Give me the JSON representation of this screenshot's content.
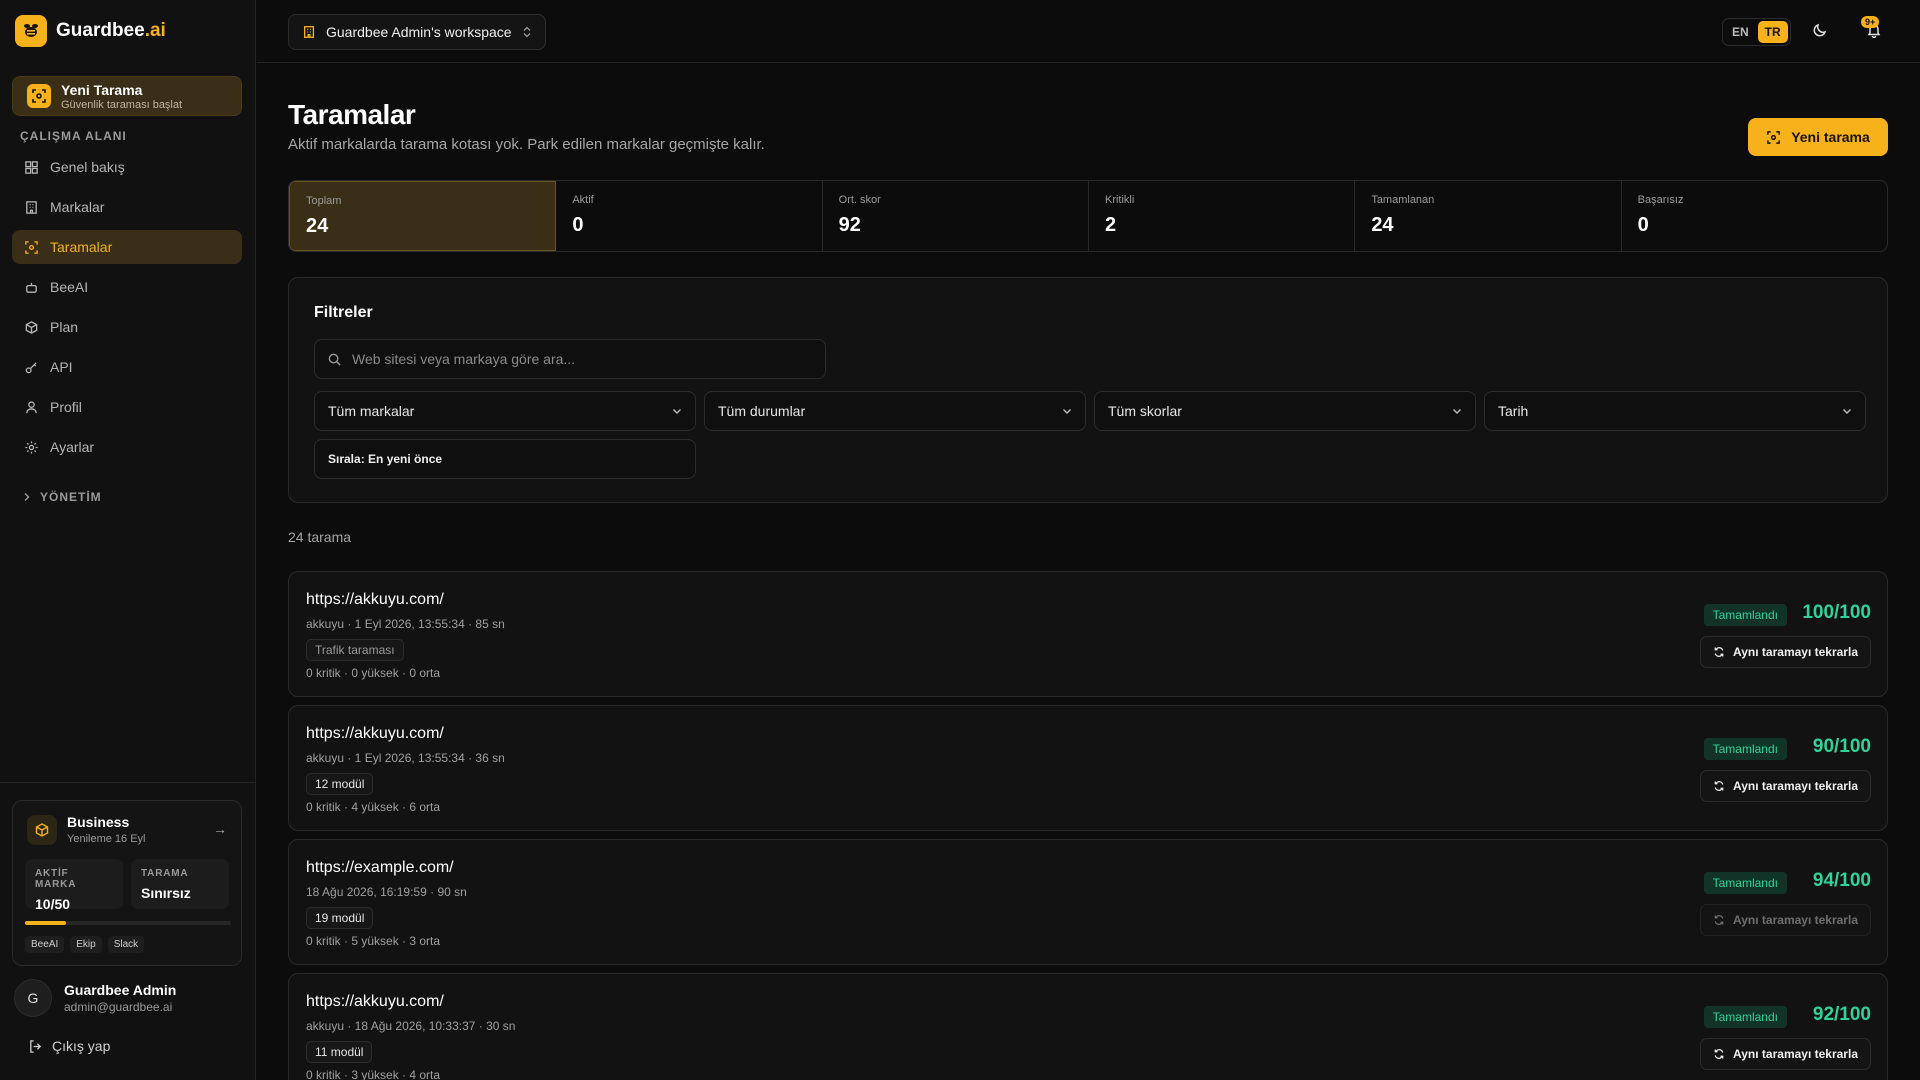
{
  "brand": {
    "name": "Guardbee",
    "suffix": ".ai",
    "color": "#f7b21b"
  },
  "sidebar": {
    "new_scan": {
      "title": "Yeni Tarama",
      "subtitle": "Güvenlik taraması başlat"
    },
    "section_label": "ÇALIŞMA ALANI",
    "items": [
      {
        "label": "Genel bakış",
        "icon": "grid-icon"
      },
      {
        "label": "Markalar",
        "icon": "building-icon"
      },
      {
        "label": "Taramalar",
        "icon": "scan-icon",
        "active": true
      },
      {
        "label": "BeeAI",
        "icon": "bot-icon"
      },
      {
        "label": "Plan",
        "icon": "box-icon"
      },
      {
        "label": "API",
        "icon": "key-icon"
      },
      {
        "label": "Profil",
        "icon": "user-icon"
      },
      {
        "label": "Ayarlar",
        "icon": "gear-icon"
      }
    ],
    "management_label": "YÖNETİM",
    "plan": {
      "name": "Business",
      "renewal": "Yenileme 16 Eyl",
      "active_brands_label": "AKTİF MARKA",
      "active_brands_value": "10/50",
      "active_brands_fraction": 0.2,
      "scan_label": "TARAMA",
      "scan_value": "Sınırsız",
      "features": [
        "BeeAI",
        "Ekip",
        "Slack"
      ]
    },
    "user": {
      "initial": "G",
      "name": "Guardbee Admin",
      "email": "admin@guardbee.ai"
    },
    "logout": "Çıkış yap"
  },
  "topbar": {
    "workspace": "Guardbee Admin's workspace",
    "lang_en": "EN",
    "lang_tr": "TR",
    "notifications_badge": "9+"
  },
  "page": {
    "title": "Taramalar",
    "subtitle": "Aktif markalarda tarama kotası yok. Park edilen markalar geçmişte kalır.",
    "new_button": "Yeni tarama"
  },
  "stats": [
    {
      "label": "Toplam",
      "value": "24"
    },
    {
      "label": "Aktif",
      "value": "0"
    },
    {
      "label": "Ort. skor",
      "value": "92"
    },
    {
      "label": "Kritikli",
      "value": "2"
    },
    {
      "label": "Tamamlanan",
      "value": "24"
    },
    {
      "label": "Başarısız",
      "value": "0"
    }
  ],
  "filters": {
    "title": "Filtreler",
    "search_placeholder": "Web sitesi veya markaya göre ara...",
    "brand": "Tüm markalar",
    "status": "Tüm durumlar",
    "score": "Tüm skorlar",
    "date": "Tarih",
    "sort": "Sırala: En yeni önce"
  },
  "results_count": "24 tarama",
  "scans": [
    {
      "url": "https://akkuyu.com/",
      "meta": "akkuyu · 1 Eyl 2026, 13:55:34 · 85 sn",
      "tag": "Trafik taraması",
      "severity": "0 kritik · 0 yüksek · 0 orta",
      "status": "Tamamlandı",
      "score": "100/100",
      "repeat": "Aynı taramayı tekrarla"
    },
    {
      "url": "https://akkuyu.com/",
      "meta": "akkuyu · 1 Eyl 2026, 13:55:34 · 36 sn",
      "tag": "12 modül",
      "severity": "0 kritik · 4 yüksek · 6 orta",
      "status": "Tamamlandı",
      "score": "90/100",
      "repeat": "Aynı taramayı tekrarla"
    },
    {
      "url": "https://example.com/",
      "meta": "18 Ağu 2026, 16:19:59 · 90 sn",
      "tag": "19 modül",
      "severity": "0 kritik · 5 yüksek · 3 orta",
      "status": "Tamamlandı",
      "score": "94/100",
      "repeat": "Aynı taramayı tekrarla"
    },
    {
      "url": "https://akkuyu.com/",
      "meta": "akkuyu · 18 Ağu 2026, 10:33:37 · 30 sn",
      "tag": "11 modül",
      "severity": "0 kritik · 3 yüksek · 4 orta",
      "status": "Tamamlandı",
      "score": "92/100",
      "repeat": "Aynı taramayı tekrarla"
    }
  ]
}
